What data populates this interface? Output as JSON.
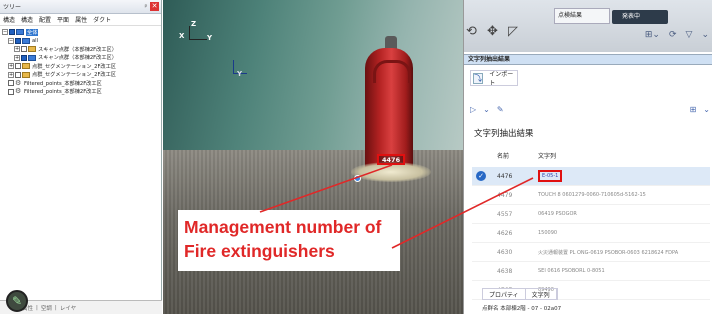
{
  "tree_pane": {
    "title": "ツリー",
    "pin_glyph": "ᵖ",
    "close_glyph": "✕",
    "menu": [
      "構造",
      "構造",
      "配置",
      "平面",
      "属性",
      "ダクト"
    ],
    "items": [
      {
        "label": "全体",
        "level": 0,
        "checked": true,
        "selected": true,
        "folder": "blue",
        "expand": "−"
      },
      {
        "label": "all",
        "level": 1,
        "checked": true,
        "folder": "blue",
        "expand": "−"
      },
      {
        "label": "スキャン点群（本部棟2F改工区）",
        "level": 2,
        "checked": false,
        "folder": "yellow",
        "expand": "+"
      },
      {
        "label": "スキャン点群（本部棟2F改工区）",
        "level": 2,
        "checked": true,
        "folder": "blue",
        "expand": "+"
      },
      {
        "label": "点群_セグメンテーション_2F改工区",
        "level": 1,
        "checked": false,
        "folder": "yellow",
        "expand": "+"
      },
      {
        "label": "点群_セグメンテーション_2F改工区",
        "level": 1,
        "checked": false,
        "folder": "yellow",
        "expand": "+"
      },
      {
        "label": "Filtered_points_本部棟2F改工区",
        "level": 1,
        "checked": false,
        "folder": "gear",
        "expand": ""
      },
      {
        "label": "Filtered_points_本部棟2F改工区",
        "level": 1,
        "checked": false,
        "folder": "gear",
        "expand": ""
      }
    ],
    "bottom_tabs": [
      "属性",
      "空調",
      "レイヤ"
    ]
  },
  "viewport": {
    "axis_labels": {
      "x": "X",
      "y": "Y",
      "z": "Z"
    },
    "tag_label": "4476"
  },
  "callout": {
    "line1": "Management number of",
    "line2": "Fire extinguishers",
    "color": "#e02828"
  },
  "right_panel": {
    "preview_tab": "点検結果",
    "status": "発表中",
    "nav_glyphs": "⟲ ✥ ◸",
    "top_tools": [
      "⊞⌄",
      "⟳",
      "▽",
      "⌄"
    ],
    "section_title": "文字列抽出結果",
    "import_label": "インポート",
    "import_icon_glyph": "⤵",
    "tool_glyphs": [
      "▷",
      "⌄",
      "✎"
    ],
    "tool_right_glyphs": [
      "⊞",
      "⌄"
    ],
    "list_heading": "文字列抽出結果",
    "columns": {
      "name": "名前",
      "text": "文字列"
    },
    "rows": [
      {
        "name": "4476",
        "text": "E-05-1",
        "active": true
      },
      {
        "name": "4479",
        "text": "TOUCH 8 0601279-0060-710605d-5162-15",
        "active": false
      },
      {
        "name": "4557",
        "text": "06419 PSOGOR",
        "active": false
      },
      {
        "name": "4626",
        "text": "150090",
        "active": false
      },
      {
        "name": "4630",
        "text": "火災通報装置 PL ONG-0619 PSOBOR-0603 6218624 FDPA",
        "active": false
      },
      {
        "name": "4638",
        "text": "SEI 0616 PSOBORL 0-8051",
        "active": false
      },
      {
        "name": "4767",
        "text": "09490",
        "active": false
      }
    ],
    "bottom_tabs": [
      "プロパティ",
      "文字列"
    ],
    "property_row": "点群名  本部棟2階 - 07 - 02a07"
  }
}
